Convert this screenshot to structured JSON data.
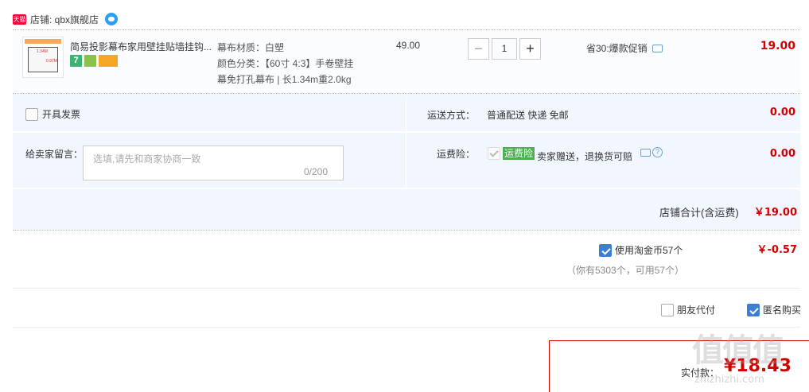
{
  "shop": {
    "badge": "天猫",
    "name": "店铺: qbx旗舰店"
  },
  "product": {
    "title": "简易投影幕布家用壁挂贴墙挂钩...",
    "attr_material": "幕布材质：白塑",
    "attr_color": "颜色分类：【60寸 4:3】手卷壁挂",
    "attr_desc": "幕免打孔幕布 | 长1.34m重2.0kg",
    "unit_price": "49.00",
    "qty_minus": "−",
    "quantity": "1",
    "qty_plus": "+",
    "promo": "省30:爆款促销",
    "total": "19.00",
    "service_7": "7",
    "thumb_label_1": "1.34M",
    "thumb_label_2": "0.97M"
  },
  "invoice": {
    "label": "开具发票"
  },
  "shipping": {
    "label": "运送方式：",
    "value": "普通配送 快递 免邮",
    "fee": "0.00"
  },
  "message": {
    "label": "给卖家留言：",
    "placeholder": "选填,请先和商家协商一致",
    "count": "0/200"
  },
  "insurance": {
    "label": "运费险：",
    "badge": "运费险",
    "text": "卖家赠送，退换货可赔",
    "help": "?",
    "fee": "0.00"
  },
  "store_total": {
    "label": "店铺合计(含运费)",
    "value": "￥19.00"
  },
  "coins": {
    "label": "使用淘金币57个",
    "value": "￥-0.57",
    "hint": "（你有5303个，可用57个）"
  },
  "options": {
    "friend_pay": "朋友代付",
    "anonymous": "匿名购买"
  },
  "payment": {
    "label": "实付款：",
    "amount": "¥18.43"
  },
  "watermark": {
    "text": "值值值",
    "domain": "zhizhizhi.com"
  },
  "colors": {
    "price_red": "#d40000",
    "panel_blue": "#f2f7ff",
    "check_blue": "#3b7ed6",
    "insurance_green": "#4caf50"
  }
}
